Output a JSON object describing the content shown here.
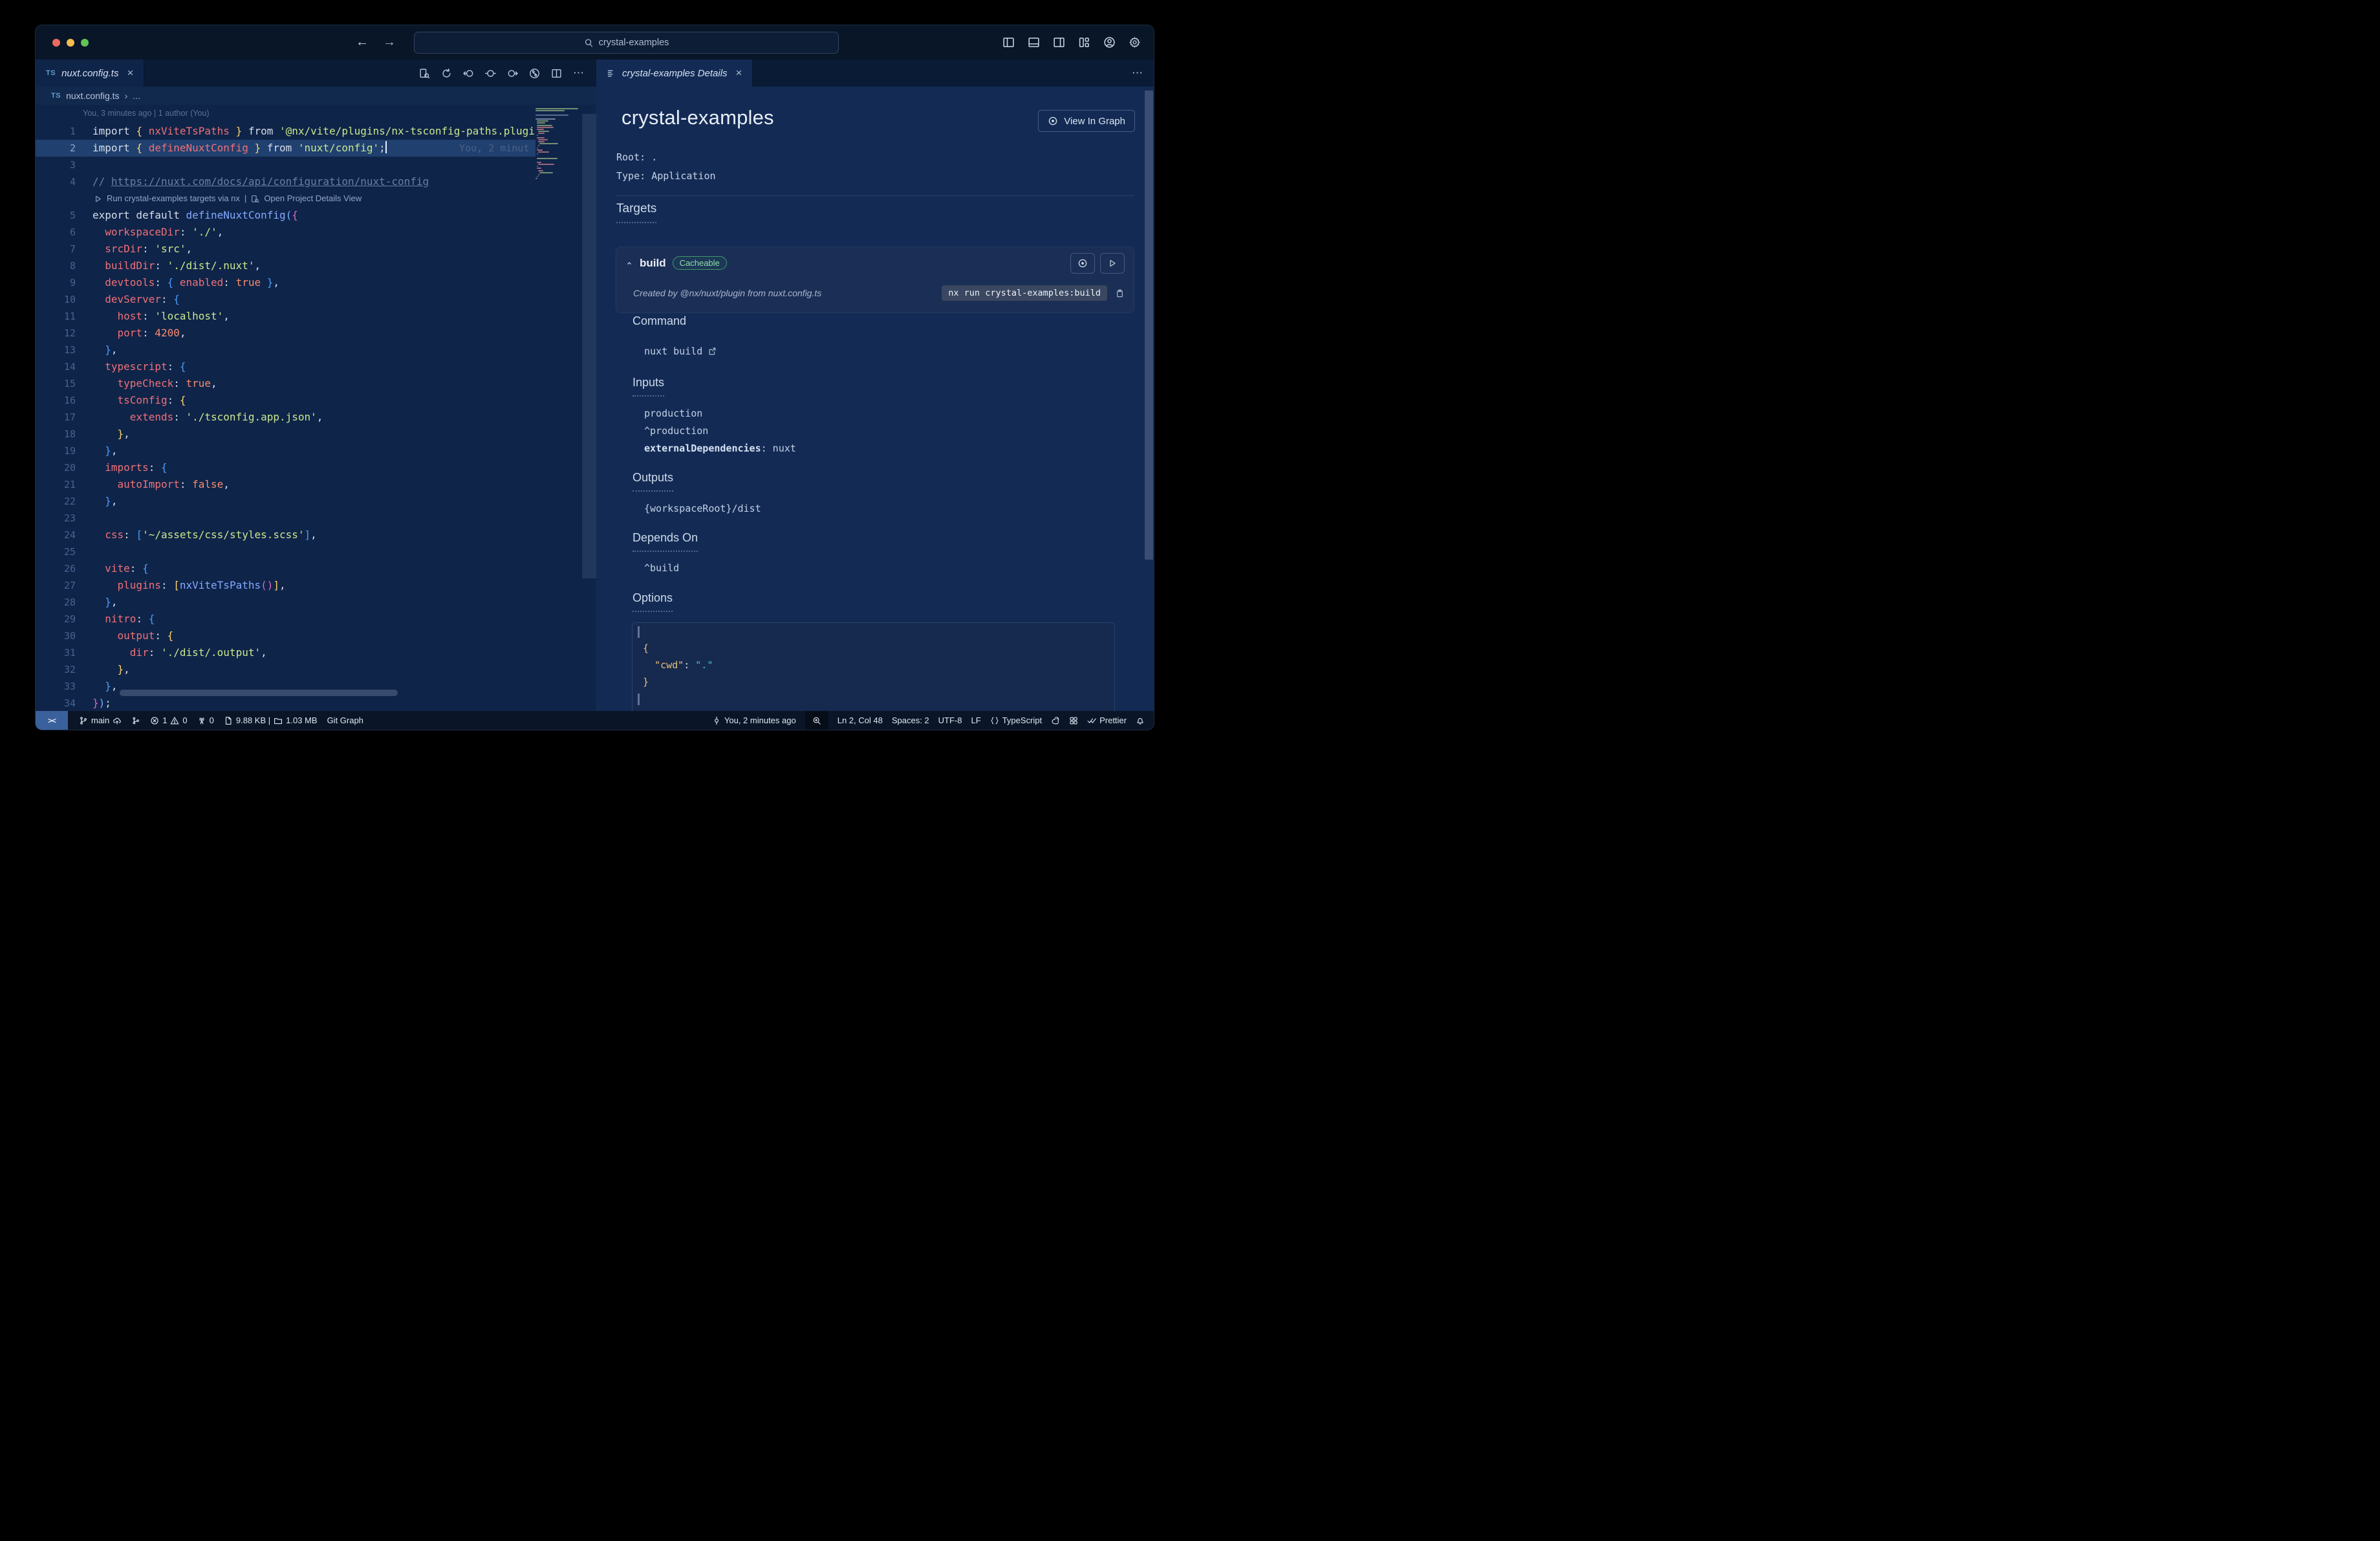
{
  "titlebar": {
    "search_value": "crystal-examples",
    "window_controls": [
      "close",
      "minimize",
      "maximize"
    ],
    "nav": {
      "back": "←",
      "forward": "→"
    },
    "right_icons": [
      "layout-sidebar-left-icon",
      "layout-panel-icon",
      "layout-sidebar-right-icon",
      "layout-grid-icon",
      "account-icon",
      "settings-gear-icon"
    ]
  },
  "editor": {
    "tab": {
      "badge": "TS",
      "label": "nuxt.config.ts",
      "close": "×"
    },
    "toolbar_icons": [
      "open-preview-icon",
      "refresh-icon",
      "previous-change-icon",
      "current-change-icon",
      "next-change-icon",
      "git-graph-circle-icon",
      "split-editor-icon",
      "more-icon"
    ],
    "breadcrumb": {
      "badge": "TS",
      "path": "nuxt.config.ts",
      "sep": "›",
      "more": "..."
    },
    "blame_header": "You, 3 minutes ago | 1 author (You)",
    "codelens": {
      "run": "Run crystal-examples targets via nx",
      "sep": "|",
      "open": "Open Project Details View"
    },
    "blame_inline": "You, 2 minut",
    "lines": [
      {
        "n": 1,
        "t": [
          [
            "w",
            "import "
          ],
          [
            "y",
            "{ "
          ],
          [
            "k",
            "nxViteTsPaths"
          ],
          [
            "y",
            " }"
          ],
          [
            "w",
            " from "
          ],
          [
            "s",
            "'@nx/vite/plugins/nx-tsconfig-paths.plugin'"
          ],
          [
            "w",
            ";"
          ]
        ]
      },
      {
        "n": 2,
        "current": true,
        "cursor": true,
        "t": [
          [
            "w",
            "import "
          ],
          [
            "y",
            "{ "
          ],
          [
            "k",
            "defineNuxtConfig"
          ],
          [
            "y",
            " }"
          ],
          [
            "w",
            " from "
          ],
          [
            "s",
            "'nuxt/config'"
          ],
          [
            "w",
            ";"
          ]
        ]
      },
      {
        "n": 3,
        "t": []
      },
      {
        "n": 4,
        "t": [
          [
            "c",
            "// "
          ],
          [
            "u",
            "https://nuxt.com/docs/api/configuration/nuxt-config"
          ]
        ]
      },
      {
        "lens": true
      },
      {
        "n": 5,
        "t": [
          [
            "w",
            "export default "
          ],
          [
            "f",
            "defineNuxtConfig"
          ],
          [
            "f",
            "("
          ],
          [
            "m",
            "{"
          ]
        ]
      },
      {
        "n": 6,
        "t": [
          [
            "k",
            "  workspaceDir"
          ],
          [
            "w",
            ": "
          ],
          [
            "s",
            "'./'"
          ],
          [
            "w",
            ","
          ]
        ]
      },
      {
        "n": 7,
        "t": [
          [
            "k",
            "  srcDir"
          ],
          [
            "w",
            ": "
          ],
          [
            "s",
            "'src'"
          ],
          [
            "w",
            ","
          ]
        ]
      },
      {
        "n": 8,
        "t": [
          [
            "k",
            "  buildDir"
          ],
          [
            "w",
            ": "
          ],
          [
            "s",
            "'./dist/.nuxt'"
          ],
          [
            "w",
            ","
          ]
        ]
      },
      {
        "n": 9,
        "t": [
          [
            "k",
            "  devtools"
          ],
          [
            "w",
            ": "
          ],
          [
            "b",
            "{ "
          ],
          [
            "k",
            "enabled"
          ],
          [
            "w",
            ": "
          ],
          [
            "o",
            "true"
          ],
          [
            "b",
            " }"
          ],
          [
            "w",
            ","
          ]
        ]
      },
      {
        "n": 10,
        "t": [
          [
            "k",
            "  devServer"
          ],
          [
            "w",
            ": "
          ],
          [
            "b",
            "{"
          ]
        ]
      },
      {
        "n": 11,
        "t": [
          [
            "k",
            "    host"
          ],
          [
            "w",
            ": "
          ],
          [
            "s",
            "'localhost'"
          ],
          [
            "w",
            ","
          ]
        ]
      },
      {
        "n": 12,
        "t": [
          [
            "k",
            "    port"
          ],
          [
            "w",
            ": "
          ],
          [
            "o",
            "4200"
          ],
          [
            "w",
            ","
          ]
        ]
      },
      {
        "n": 13,
        "t": [
          [
            "b",
            "  }"
          ],
          [
            "w",
            ","
          ]
        ]
      },
      {
        "n": 14,
        "t": [
          [
            "k",
            "  typescript"
          ],
          [
            "w",
            ": "
          ],
          [
            "b",
            "{"
          ]
        ]
      },
      {
        "n": 15,
        "t": [
          [
            "k",
            "    typeCheck"
          ],
          [
            "w",
            ": "
          ],
          [
            "o",
            "true"
          ],
          [
            "w",
            ","
          ]
        ]
      },
      {
        "n": 16,
        "t": [
          [
            "k",
            "    tsConfig"
          ],
          [
            "w",
            ": "
          ],
          [
            "y",
            "{"
          ]
        ]
      },
      {
        "n": 17,
        "t": [
          [
            "k",
            "      extends"
          ],
          [
            "w",
            ": "
          ],
          [
            "s",
            "'./tsconfig.app.json'"
          ],
          [
            "w",
            ","
          ]
        ]
      },
      {
        "n": 18,
        "t": [
          [
            "y",
            "    }"
          ],
          [
            "w",
            ","
          ]
        ]
      },
      {
        "n": 19,
        "t": [
          [
            "b",
            "  }"
          ],
          [
            "w",
            ","
          ]
        ]
      },
      {
        "n": 20,
        "t": [
          [
            "k",
            "  imports"
          ],
          [
            "w",
            ": "
          ],
          [
            "b",
            "{"
          ]
        ]
      },
      {
        "n": 21,
        "t": [
          [
            "k",
            "    autoImport"
          ],
          [
            "w",
            ": "
          ],
          [
            "o",
            "false"
          ],
          [
            "w",
            ","
          ]
        ]
      },
      {
        "n": 22,
        "t": [
          [
            "b",
            "  }"
          ],
          [
            "w",
            ","
          ]
        ]
      },
      {
        "n": 23,
        "t": []
      },
      {
        "n": 24,
        "t": [
          [
            "k",
            "  css"
          ],
          [
            "w",
            ": "
          ],
          [
            "b",
            "["
          ],
          [
            "s",
            "'~/assets/css/styles.scss'"
          ],
          [
            "b",
            "]"
          ],
          [
            "w",
            ","
          ]
        ]
      },
      {
        "n": 25,
        "t": []
      },
      {
        "n": 26,
        "t": [
          [
            "k",
            "  vite"
          ],
          [
            "w",
            ": "
          ],
          [
            "b",
            "{"
          ]
        ]
      },
      {
        "n": 27,
        "t": [
          [
            "k",
            "    plugins"
          ],
          [
            "w",
            ": "
          ],
          [
            "y",
            "["
          ],
          [
            "f",
            "nxViteTsPaths"
          ],
          [
            "m",
            "()"
          ],
          [
            "y",
            "]"
          ],
          [
            "w",
            ","
          ]
        ]
      },
      {
        "n": 28,
        "t": [
          [
            "b",
            "  }"
          ],
          [
            "w",
            ","
          ]
        ]
      },
      {
        "n": 29,
        "t": [
          [
            "k",
            "  nitro"
          ],
          [
            "w",
            ": "
          ],
          [
            "b",
            "{"
          ]
        ]
      },
      {
        "n": 30,
        "t": [
          [
            "k",
            "    output"
          ],
          [
            "w",
            ": "
          ],
          [
            "y",
            "{"
          ]
        ]
      },
      {
        "n": 31,
        "t": [
          [
            "k",
            "      dir"
          ],
          [
            "w",
            ": "
          ],
          [
            "s",
            "'./dist/.output'"
          ],
          [
            "w",
            ","
          ]
        ]
      },
      {
        "n": 32,
        "t": [
          [
            "y",
            "    }"
          ],
          [
            "w",
            ","
          ]
        ]
      },
      {
        "n": 33,
        "t": [
          [
            "b",
            "  }"
          ],
          [
            "w",
            ","
          ]
        ]
      },
      {
        "n": 34,
        "t": [
          [
            "m",
            "}"
          ],
          [
            "f",
            ")"
          ],
          [
            "w",
            ";"
          ]
        ]
      }
    ]
  },
  "panel": {
    "tab": {
      "label": "crystal-examples Details",
      "close": "×"
    },
    "more": "⋯",
    "title": "crystal-examples",
    "view_in_graph": "View In Graph",
    "root_label": "Root:",
    "root_value": ".",
    "type_label": "Type:",
    "type_value": "Application",
    "targets_heading": "Targets",
    "target": {
      "name": "build",
      "badge": "Cacheable",
      "created_by": "Created by @nx/nuxt/plugin from nuxt.config.ts",
      "command_chip": "nx run crystal-examples:build"
    },
    "sections": [
      {
        "heading": "Command",
        "dotted": false,
        "items": [
          {
            "text": "nuxt build",
            "icon": "external-link-icon"
          }
        ]
      },
      {
        "heading": "Inputs",
        "dotted": true,
        "items": [
          {
            "text": "production"
          },
          {
            "text": "^production"
          },
          {
            "bold": "externalDependencies",
            "text": ": nuxt"
          }
        ]
      },
      {
        "heading": "Outputs",
        "dotted": true,
        "items": [
          {
            "text": "{workspaceRoot}/dist"
          }
        ]
      },
      {
        "heading": "Depends On",
        "dotted": true,
        "items": [
          {
            "text": "^build"
          }
        ]
      },
      {
        "heading": "Options",
        "dotted": true,
        "items": []
      }
    ],
    "options_code": {
      "lines": [
        {
          "bar": true,
          "t": []
        },
        {
          "t": [
            [
              "jy",
              "{"
            ]
          ]
        },
        {
          "t": [
            [
              "jy",
              "  \"cwd\""
            ],
            [
              "jw",
              ": "
            ],
            [
              "jt",
              "\".\""
            ]
          ]
        },
        {
          "t": [
            [
              "jy",
              "}"
            ]
          ]
        },
        {
          "bar": true,
          "t": []
        }
      ]
    }
  },
  "status_bar": {
    "left": [
      {
        "name": "remote-indicator",
        "remote": true,
        "segs": [
          {
            "tx": "><"
          }
        ]
      },
      {
        "name": "git-branch",
        "segs": [
          {
            "ic": "branch-icon"
          },
          {
            "tx": "main"
          },
          {
            "ic": "cloud-upload-icon"
          }
        ]
      },
      {
        "name": "source-control-graph",
        "segs": [
          {
            "ic": "sc-graph-icon"
          }
        ]
      },
      {
        "name": "problems",
        "segs": [
          {
            "ic": "error-icon"
          },
          {
            "tx": "1"
          },
          {
            "ic": "warning-icon"
          },
          {
            "tx": "0"
          }
        ]
      },
      {
        "name": "ports",
        "segs": [
          {
            "ic": "broadcast-icon"
          },
          {
            "tx": "0"
          }
        ]
      },
      {
        "name": "file-size",
        "segs": [
          {
            "ic": "file-icon"
          },
          {
            "tx": "9.88 KB |"
          },
          {
            "ic": "folder-icon"
          },
          {
            "tx": "1.03 MB"
          }
        ]
      },
      {
        "name": "git-graph",
        "segs": [
          {
            "tx": "Git Graph"
          }
        ]
      }
    ],
    "right": [
      {
        "name": "blame",
        "segs": [
          {
            "ic": "commit-icon"
          },
          {
            "tx": "You, 2 minutes ago"
          }
        ]
      },
      {
        "name": "zoom",
        "dark": true,
        "segs": [
          {
            "ic": "zoom-in-icon"
          }
        ]
      },
      {
        "name": "cursor-position",
        "segs": [
          {
            "tx": "Ln 2, Col 48"
          }
        ]
      },
      {
        "name": "indentation",
        "segs": [
          {
            "tx": "Spaces: 2"
          }
        ]
      },
      {
        "name": "encoding",
        "segs": [
          {
            "tx": "UTF-8"
          }
        ]
      },
      {
        "name": "eol",
        "segs": [
          {
            "tx": "LF"
          }
        ]
      },
      {
        "name": "language",
        "segs": [
          {
            "ic": "braces-icon"
          },
          {
            "tx": "TypeScript"
          }
        ]
      },
      {
        "name": "squirrel",
        "segs": [
          {
            "ic": "squirrel-icon"
          }
        ]
      },
      {
        "name": "extension",
        "segs": [
          {
            "ic": "grid-face-icon"
          }
        ]
      },
      {
        "name": "prettier",
        "segs": [
          {
            "ic": "double-check-icon"
          },
          {
            "tx": "Prettier"
          }
        ]
      },
      {
        "name": "notifications",
        "segs": [
          {
            "ic": "bell-icon"
          }
        ]
      }
    ]
  }
}
